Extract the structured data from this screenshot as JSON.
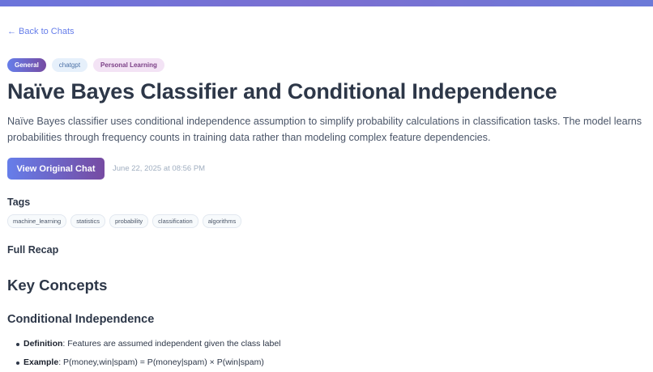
{
  "nav": {
    "back_label": "← Back to Chats"
  },
  "chips": [
    {
      "label": "General"
    },
    {
      "label": "chatgpt"
    },
    {
      "label": "Personal Learning"
    }
  ],
  "header": {
    "title": "Naïve Bayes Classifier and Conditional Independence",
    "summary": "Naïve Bayes classifier uses conditional independence assumption to simplify probability calculations in classification tasks. The model learns probabilities through frequency counts in training data rather than modeling complex feature dependencies.",
    "view_button_label": "View Original Chat",
    "date": "June 22, 2025 at 08:56 PM"
  },
  "tags": {
    "heading": "Tags",
    "items": [
      "machine_learning",
      "statistics",
      "probability",
      "classification",
      "algorithms"
    ]
  },
  "recap": {
    "heading": "Full Recap",
    "h2": "Key Concepts",
    "h3": "Conditional Independence",
    "bullets": [
      {
        "term": "Definition",
        "text": ": Features are assumed independent given the class label"
      },
      {
        "term": "Example",
        "text": ": P(money,win|spam) = P(money|spam) × P(win|spam)"
      }
    ]
  },
  "colors": {
    "accent": "#667eea",
    "accent_end": "#764ba2",
    "text": "#2d3748",
    "muted": "#a0aec0"
  }
}
